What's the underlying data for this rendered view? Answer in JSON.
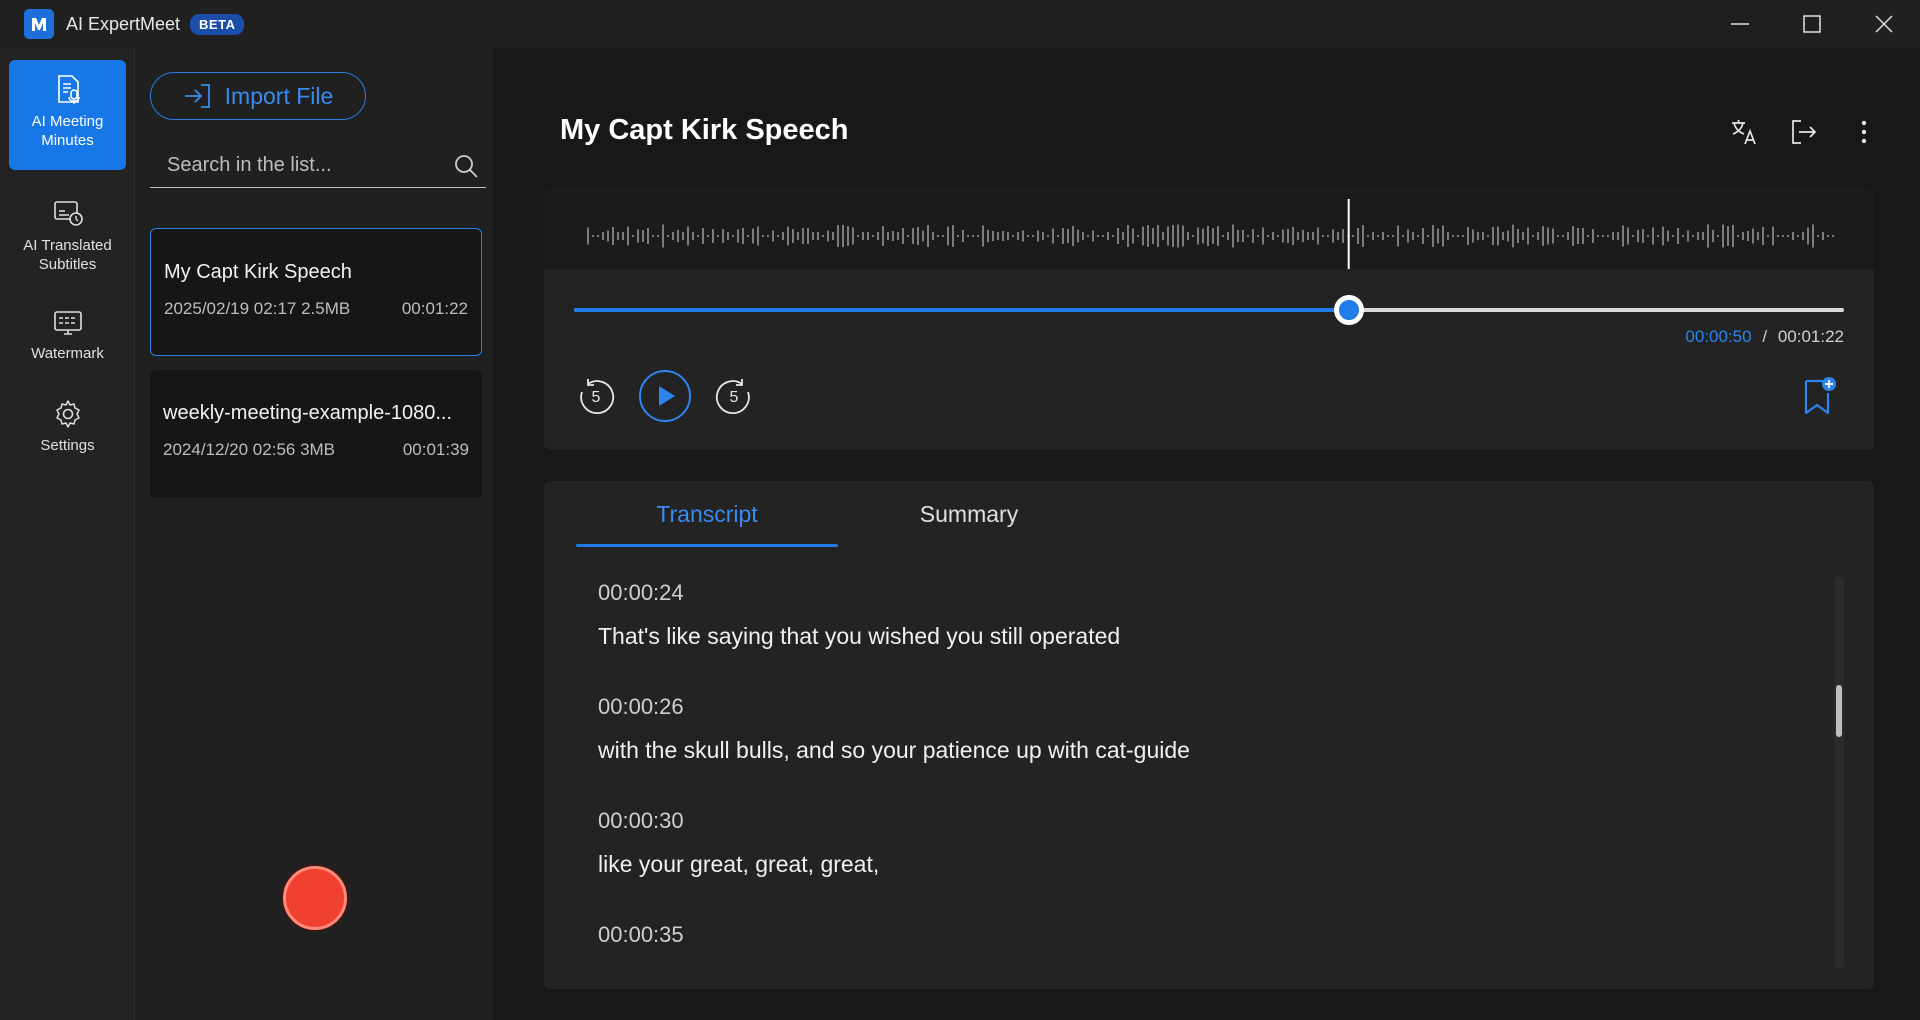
{
  "app": {
    "title": "AI ExpertMeet",
    "badge": "BETA"
  },
  "nav": {
    "items": [
      {
        "label": "AI Meeting Minutes",
        "icon": "meeting-minutes-icon",
        "active": true
      },
      {
        "label": "AI Translated Subtitles",
        "icon": "subtitles-icon",
        "active": false
      },
      {
        "label": "Watermark",
        "icon": "watermark-icon",
        "active": false
      },
      {
        "label": "Settings",
        "icon": "gear-icon",
        "active": false
      }
    ]
  },
  "filelist": {
    "import_label": "Import File",
    "search_placeholder": "Search in the list...",
    "files": [
      {
        "name": "My Capt Kirk Speech",
        "meta": "2025/02/19 02:17 2.5MB",
        "duration": "00:01:22",
        "selected": true
      },
      {
        "name": "weekly-meeting-example-1080...",
        "meta": "2024/12/20 02:56 3MB",
        "duration": "00:01:39",
        "selected": false
      }
    ]
  },
  "main": {
    "title": "My Capt Kirk Speech",
    "player": {
      "current_time": "00:00:50",
      "separator": "/",
      "total_time": "00:01:22",
      "progress": 0.61,
      "skip_back_seconds": "5",
      "skip_forward_seconds": "5"
    },
    "tabs": [
      {
        "label": "Transcript",
        "active": true
      },
      {
        "label": "Summary",
        "active": false
      }
    ],
    "transcript": [
      {
        "time": "00:00:24",
        "text": "That's like saying that you wished you still operated"
      },
      {
        "time": "00:00:26",
        "text": "with the skull bulls, and so your patience up with cat-guide"
      },
      {
        "time": "00:00:30",
        "text": "like your great, great, great,"
      },
      {
        "time": "00:00:35",
        "text": ""
      }
    ]
  },
  "colors": {
    "accent": "#1f7ce8",
    "record": "#f04130",
    "background": "#181818"
  }
}
